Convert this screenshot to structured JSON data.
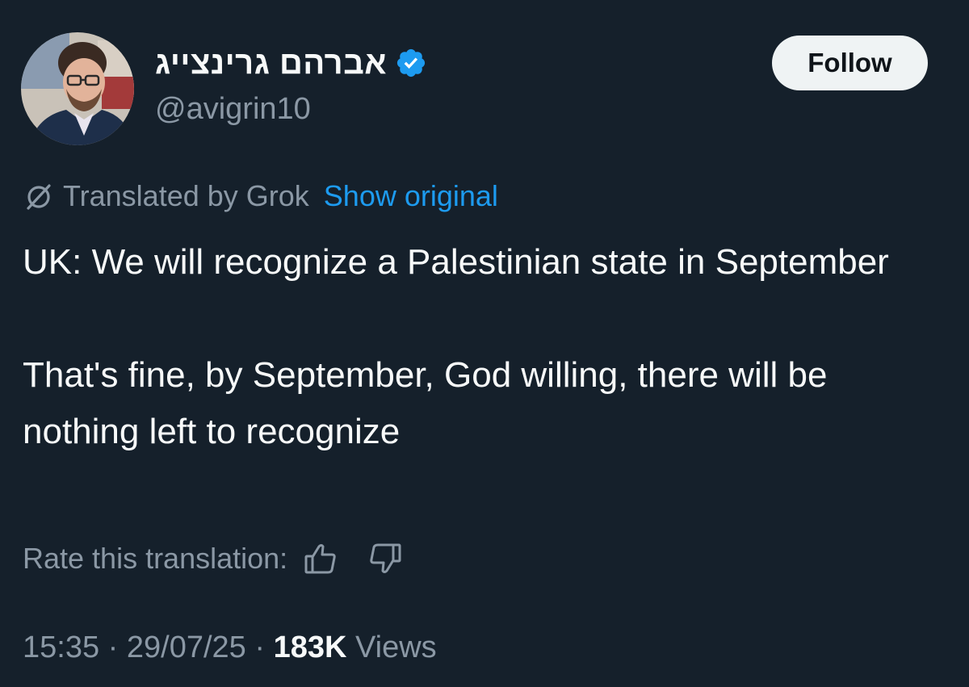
{
  "author": {
    "display_name": "אברהם גרינצייג",
    "handle": "@avigrin10",
    "verified": true,
    "avatar_icon": "profile-photo"
  },
  "follow_button": {
    "label": "Follow"
  },
  "translation": {
    "label": "Translated by Grok",
    "show_original": "Show original",
    "icon": "grok-icon"
  },
  "tweet": {
    "paragraphs": [
      "UK: We will recognize a Palestinian state in September",
      "That's fine, by September, God willing, there will be nothing left to recognize"
    ]
  },
  "rate": {
    "label": "Rate this translation:",
    "up_icon": "thumbs-up-icon",
    "down_icon": "thumbs-down-icon"
  },
  "meta": {
    "time": "15:35",
    "date": "29/07/25",
    "views_count": "183K",
    "views_label": "Views",
    "separator": "·"
  },
  "colors": {
    "background": "#15202b",
    "text": "#f7f9f9",
    "secondary": "#8b98a5",
    "accent": "#1d9bf0",
    "follow_bg": "#eff3f4"
  }
}
